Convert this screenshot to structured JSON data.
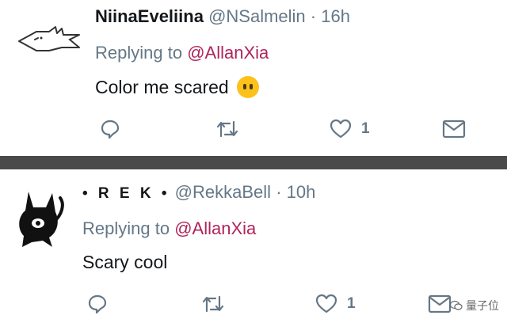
{
  "tweets": [
    {
      "display_name": "NiinaEveliina",
      "handle": "@NSalmelin",
      "separator": "·",
      "time": "16h",
      "replying_prefix": "Replying to",
      "replying_to": "@AllanXia",
      "text": "Color me scared",
      "emoji": "face-without-mouth",
      "like_count": "1"
    },
    {
      "display_name": "• R E K •",
      "handle": "@RekkaBell",
      "separator": "·",
      "time": "10h",
      "replying_prefix": "Replying to",
      "replying_to": "@AllanXia",
      "text": "Scary cool",
      "like_count": "1"
    }
  ],
  "watermark": {
    "text": "量子位"
  },
  "colors": {
    "mention": "#b0245b",
    "muted": "#657786",
    "divider": "#4a4a4a"
  },
  "icons": [
    "reply-icon",
    "retweet-icon",
    "like-icon",
    "share-icon"
  ]
}
